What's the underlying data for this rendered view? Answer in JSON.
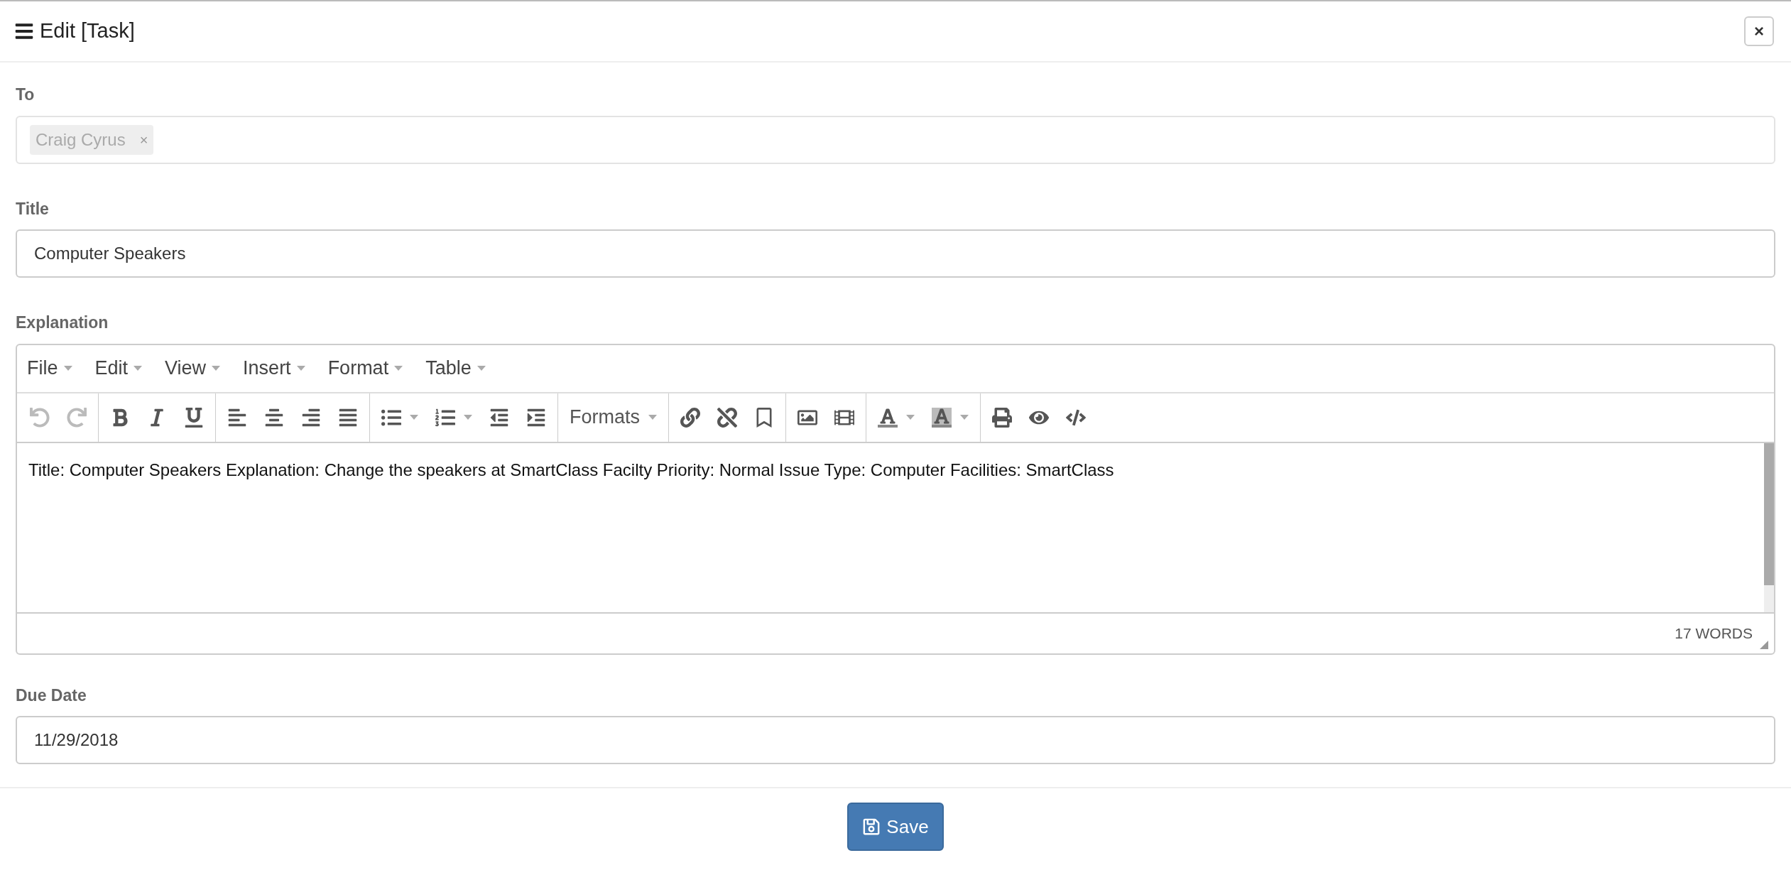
{
  "dialog": {
    "title": "Edit [Task]",
    "close": "×"
  },
  "to": {
    "label": "To",
    "tags": [
      {
        "name": "Craig Cyrus",
        "remove": "×"
      }
    ]
  },
  "title_field": {
    "label": "Title",
    "value": "Computer Speakers"
  },
  "explanation": {
    "label": "Explanation",
    "menu": [
      "File",
      "Edit",
      "View",
      "Insert",
      "Format",
      "Table"
    ],
    "toolbar": {
      "undo_disabled": true,
      "redo_disabled": true,
      "formats": "Formats"
    },
    "content": "Title: Computer Speakers Explanation: Change the speakers at SmartClass Facilty Priority: Normal Issue Type: Computer Facilities: SmartClass",
    "word_count": "17 WORDS"
  },
  "due_date": {
    "label": "Due Date",
    "value": "11/29/2018"
  },
  "save": "Save"
}
